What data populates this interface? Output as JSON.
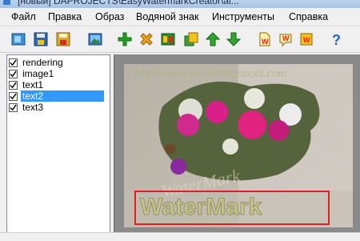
{
  "window": {
    "title": "[новый] DAPROJECTS\\EasyWatermarkCreator\\al..."
  },
  "menu": [
    "Файл",
    "Правка",
    "Образ",
    "Водяной знак",
    "Инструменты",
    "Справка"
  ],
  "toolbar": {
    "buttons": [
      "open-project",
      "save-project",
      "save-as",
      "open-image",
      "add",
      "delete",
      "properties",
      "copy",
      "move-up",
      "move-down",
      "new-watermark",
      "edit-watermark",
      "save-watermark",
      "help"
    ],
    "colors": {
      "green": "#22a020",
      "red": "#d92b1b",
      "blue": "#2e62b8",
      "yellow": "#f4c21a",
      "orange": "#e67e17"
    }
  },
  "layers": [
    {
      "label": "rendering",
      "checked": true,
      "selected": false
    },
    {
      "label": "image1",
      "checked": true,
      "selected": false
    },
    {
      "label": "text1",
      "checked": true,
      "selected": false
    },
    {
      "label": "text2",
      "checked": true,
      "selected": true
    },
    {
      "label": "text3",
      "checked": true,
      "selected": false
    }
  ],
  "preview": {
    "url_text": "http://www.easyimagetools.com",
    "watermark_text": "WaterMark",
    "selection_color": "#e02020",
    "bg_color": "#8a8a8a"
  }
}
